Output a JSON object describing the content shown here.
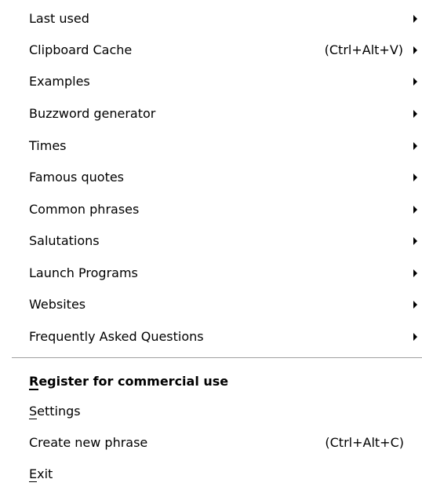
{
  "menu": {
    "submenu_items": [
      {
        "label": "Last used",
        "shortcut": ""
      },
      {
        "label": "Clipboard Cache",
        "shortcut": "(Ctrl+Alt+V)"
      },
      {
        "label": "Examples",
        "shortcut": ""
      },
      {
        "label": "Buzzword generator",
        "shortcut": ""
      },
      {
        "label": "Times",
        "shortcut": ""
      },
      {
        "label": "Famous quotes",
        "shortcut": ""
      },
      {
        "label": "Common phrases",
        "shortcut": ""
      },
      {
        "label": "Salutations",
        "shortcut": ""
      },
      {
        "label": "Launch Programs",
        "shortcut": ""
      },
      {
        "label": "Websites",
        "shortcut": ""
      },
      {
        "label": "Frequently Asked Questions",
        "shortcut": ""
      }
    ],
    "register_label": "Register for commercial use",
    "settings_label": "Settings",
    "create_phrase_label": "Create new phrase",
    "create_phrase_shortcut": "(Ctrl+Alt+C)",
    "exit_label": "Exit",
    "submenu_arrow_icon": "triangle-right-icon"
  }
}
